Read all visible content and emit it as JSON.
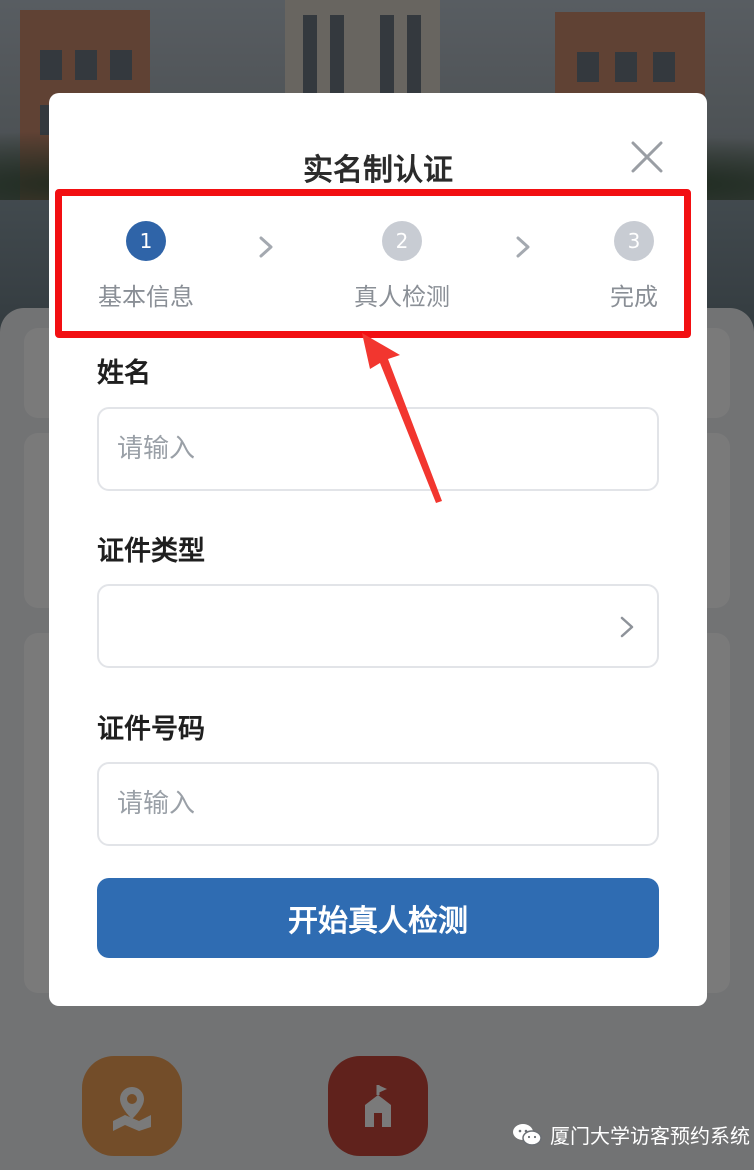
{
  "modal": {
    "title": "实名制认证",
    "steps": [
      {
        "number": "1",
        "label": "基本信息",
        "state": "active"
      },
      {
        "number": "2",
        "label": "真人检测",
        "state": "inactive"
      },
      {
        "number": "3",
        "label": "完成",
        "state": "inactive"
      }
    ],
    "fields": {
      "name_label": "姓名",
      "name_placeholder": "请输入",
      "id_type_label": "证件类型",
      "id_type_value": "",
      "id_number_label": "证件号码",
      "id_number_placeholder": "请输入"
    },
    "submit_label": "开始真人检测"
  },
  "watermark": {
    "text": "厦门大学访客预约系统",
    "icon": "wechat-icon"
  },
  "icons": {
    "close": "close-icon",
    "step_separator": "chevron-right-icon",
    "select_arrow": "chevron-right-icon",
    "background_apps": [
      "map-location-icon",
      "school-icon"
    ]
  },
  "colors": {
    "primary": "#2f6cb2",
    "step_active": "#2f64a8",
    "step_inactive": "#c8ccd3",
    "annotation": "#f20f12"
  }
}
